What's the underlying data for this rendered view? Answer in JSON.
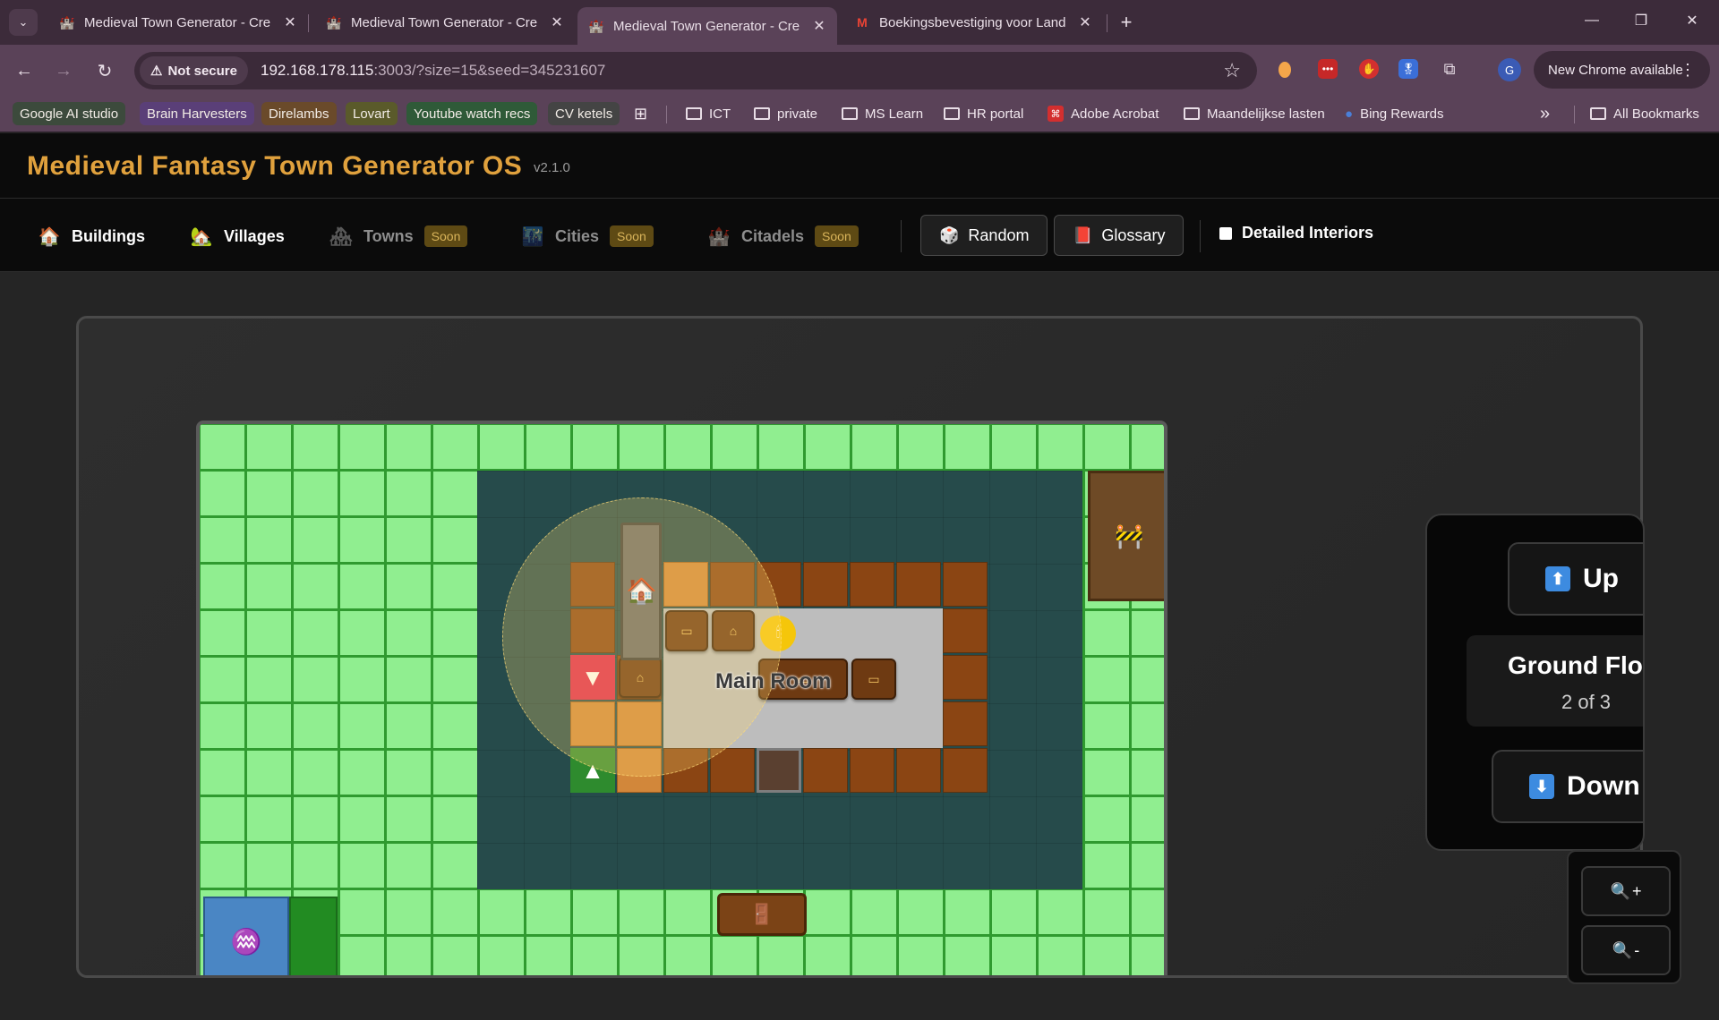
{
  "browser": {
    "tabs": [
      {
        "title": "Medieval Town Generator - Cre",
        "active": false
      },
      {
        "title": "Medieval Town Generator - Cre",
        "active": false
      },
      {
        "title": "Medieval Town Generator - Cre",
        "active": true
      },
      {
        "title": "Boekingsbevestiging voor Land",
        "active": false
      }
    ],
    "security_label": "Not secure",
    "url_host": "192.168.178.115",
    "url_rest": ":3003/?size=15&seed=345231607",
    "new_chrome_label": "New Chrome available",
    "profile_initial": "G",
    "bookmarks_chips": [
      {
        "label": "Google AI studio",
        "color": "#3c4a3c"
      },
      {
        "label": "Brain Harvesters",
        "color": "#5a3f78"
      },
      {
        "label": "Direlambs",
        "color": "#6a4a2a"
      },
      {
        "label": "Lovart",
        "color": "#5a5a2a"
      },
      {
        "label": "Youtube watch recs",
        "color": "#2f5a38"
      },
      {
        "label": "CV ketels",
        "color": "#444444"
      }
    ],
    "bookmarks_folders": [
      "ICT",
      "private",
      "MS Learn",
      "HR portal",
      "Adobe Acrobat",
      "Maandelijkse lasten",
      "Bing Rewards"
    ],
    "all_bookmarks": "All Bookmarks"
  },
  "app": {
    "title": "Medieval Fantasy Town Generator OS",
    "version": "v2.1.0",
    "nav": {
      "buildings": "Buildings",
      "villages": "Villages",
      "towns": "Towns",
      "cities": "Cities",
      "citadels": "Citadels",
      "soon": "Soon",
      "random": "Random",
      "glossary": "Glossary",
      "detailed_interiors": "Detailed Interiors"
    },
    "map": {
      "room_label": "Main Room"
    },
    "floor": {
      "up": "Up",
      "name": "Ground Flo",
      "count": "2 of 3",
      "down": "Down"
    },
    "zoom": {
      "in": "+",
      "out": "-"
    },
    "colors": {
      "accent": "#e0a13d",
      "grass": "#90ee90",
      "building_interior": "#264b4b",
      "wall": "#8b4513",
      "stair_down": "#e0264e",
      "stair_up": "#2e8b2e"
    }
  }
}
